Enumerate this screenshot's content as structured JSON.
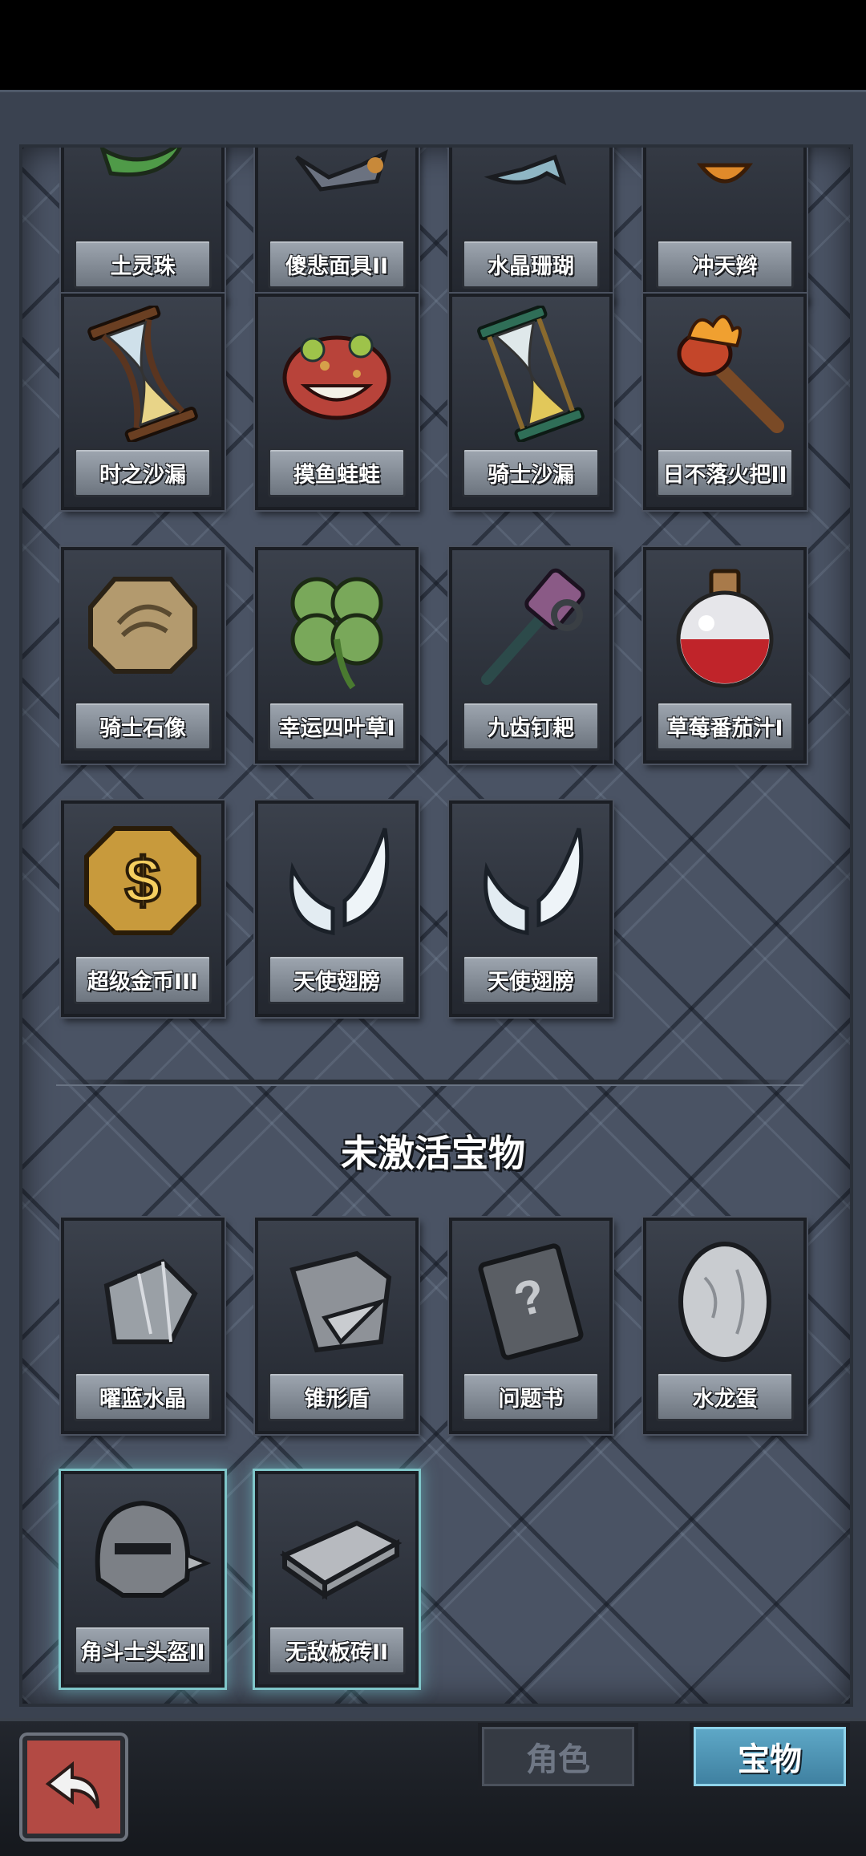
{
  "active_items": [
    {
      "name": "土灵珠",
      "icon": "earth-orb-icon"
    },
    {
      "name": "傻悲面具II",
      "icon": "sad-mask-icon"
    },
    {
      "name": "水晶珊瑚",
      "icon": "crystal-coral-icon"
    },
    {
      "name": "冲天辫",
      "icon": "pigtail-icon"
    },
    {
      "name": "时之沙漏",
      "icon": "hourglass-icon"
    },
    {
      "name": "摸鱼蛙蛙",
      "icon": "frog-icon"
    },
    {
      "name": "骑士沙漏",
      "icon": "knight-hourglass-icon"
    },
    {
      "name": "日不落火把II",
      "icon": "torch-icon"
    },
    {
      "name": "骑士石像",
      "icon": "stone-statue-icon"
    },
    {
      "name": "幸运四叶草I",
      "icon": "four-leaf-clover-icon"
    },
    {
      "name": "九齿钉耙",
      "icon": "rake-icon"
    },
    {
      "name": "草莓番茄汁I",
      "icon": "potion-icon"
    },
    {
      "name": "超级金币III",
      "icon": "gold-coin-icon"
    },
    {
      "name": "天使翅膀",
      "icon": "angel-wings-icon"
    },
    {
      "name": "天使翅膀",
      "icon": "angel-wings-icon"
    }
  ],
  "inactive_title": "未激活宝物",
  "inactive_items": [
    {
      "name": "曜蓝水晶",
      "icon": "crystal-icon"
    },
    {
      "name": "锥形盾",
      "icon": "spiked-shield-icon"
    },
    {
      "name": "问题书",
      "icon": "question-book-icon"
    },
    {
      "name": "水龙蛋",
      "icon": "dragon-egg-icon"
    },
    {
      "name": "角斗士头盔II",
      "icon": "gladiator-helmet-icon"
    },
    {
      "name": "无敌板砖II",
      "icon": "brick-icon"
    }
  ],
  "tabs": {
    "role": "角色",
    "treasure": "宝物"
  },
  "colors": {
    "active_tab": "#4f97b8",
    "back_button": "#b34a44",
    "glow": "#7fc6c9"
  }
}
